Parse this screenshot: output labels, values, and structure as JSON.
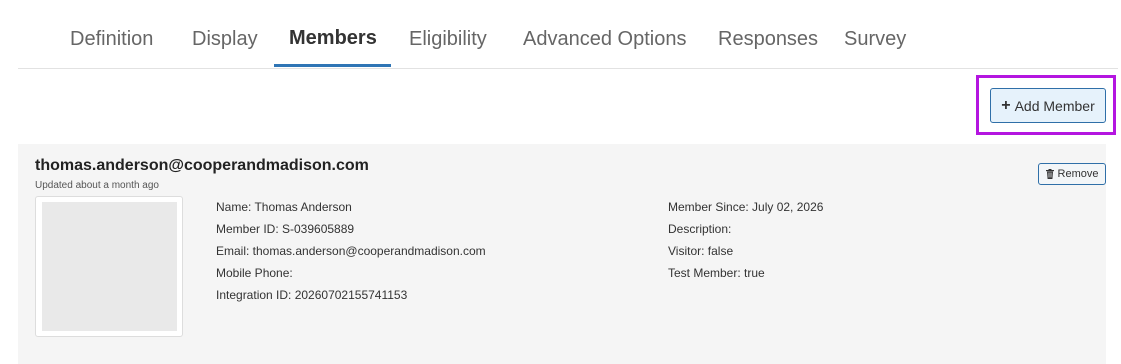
{
  "tabs": [
    {
      "label": "Definition"
    },
    {
      "label": "Display"
    },
    {
      "label": "Members",
      "active": true
    },
    {
      "label": "Eligibility"
    },
    {
      "label": "Advanced Options"
    },
    {
      "label": "Responses"
    },
    {
      "label": "Survey"
    }
  ],
  "toolbar": {
    "add_member_label": "Add Member"
  },
  "member": {
    "email": "thomas.anderson@cooperandmadison.com",
    "updated": "Updated about a month ago",
    "remove_label": "Remove",
    "left_fields": [
      "Name: Thomas Anderson",
      "Member ID: S-039605889",
      "Email: thomas.anderson@cooperandmadison.com",
      "Mobile Phone:",
      "Integration ID: 20260702155741153"
    ],
    "right_fields": [
      "Member Since: July 02, 2026",
      "Description:",
      "Visitor: false",
      "Test Member: true"
    ]
  },
  "colors": {
    "accent": "#2f75b5",
    "highlight": "#b415e0",
    "card_bg": "#f5f5f5"
  },
  "icons": {
    "add": "plus-icon",
    "remove": "trash-icon"
  }
}
